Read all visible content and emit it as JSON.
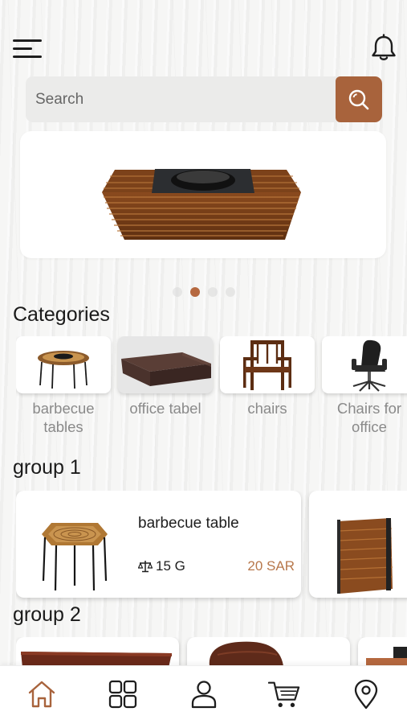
{
  "search": {
    "placeholder": "Search"
  },
  "banner": {
    "image": "barbecue-table-icon",
    "slides": 4,
    "active_slide": 1
  },
  "categories": {
    "title": "Categories",
    "items": [
      {
        "label": "barbecue\ntables",
        "icon": "barbecue-table-icon"
      },
      {
        "label": "office tabel",
        "icon": "office-desk-icon"
      },
      {
        "label": "chairs",
        "icon": "wooden-chair-icon"
      },
      {
        "label": "Chairs for\noffice",
        "icon": "office-chair-icon"
      }
    ]
  },
  "group1": {
    "title": "group 1",
    "product": {
      "name": "barbecue table",
      "weight": "15 G",
      "price": "20 SAR"
    }
  },
  "group2": {
    "title": "group 2"
  },
  "bottom_nav": [
    "home-icon",
    "grid-icon",
    "profile-icon",
    "cart-icon",
    "location-icon"
  ],
  "colors": {
    "accent": "#A8633C",
    "price": "#B7774B",
    "text": "#1E1E1E",
    "muted": "#8A8A8A"
  }
}
